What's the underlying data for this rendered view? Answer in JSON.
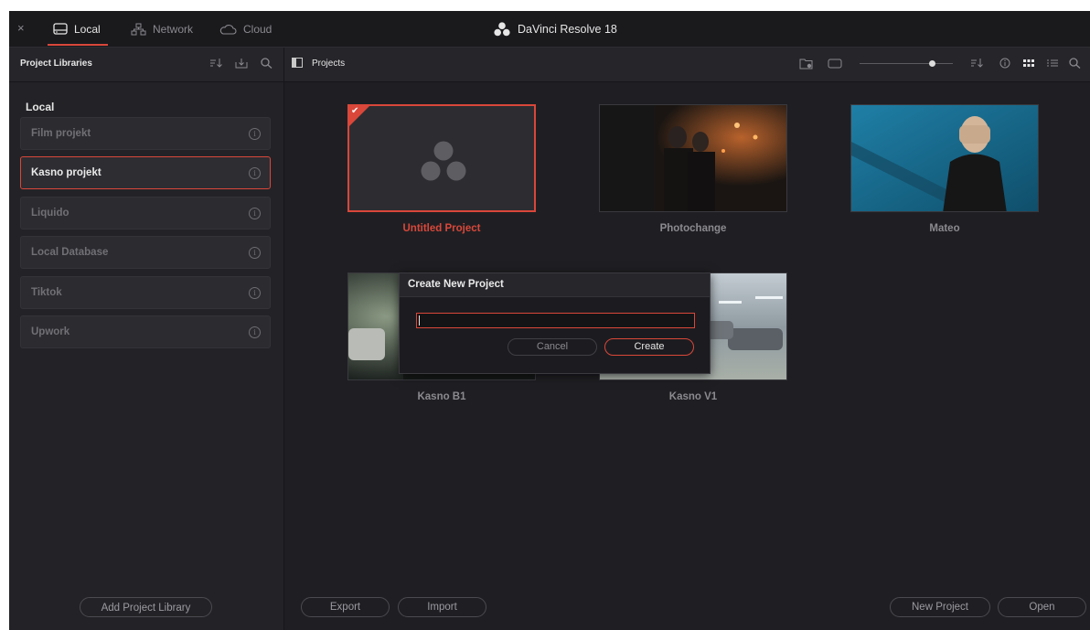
{
  "titlebar": {
    "tabs": [
      {
        "label": "Local",
        "icon": "drive-icon",
        "active": true
      },
      {
        "label": "Network",
        "icon": "network-icon",
        "active": false
      },
      {
        "label": "Cloud",
        "icon": "cloud-icon",
        "active": false
      }
    ],
    "app_title": "DaVinci Resolve 18",
    "close_label": "×"
  },
  "left_panel": {
    "title": "Project Libraries",
    "section_heading": "Local",
    "libraries": [
      {
        "label": "Film projekt",
        "selected": false
      },
      {
        "label": "Kasno projekt",
        "selected": true
      },
      {
        "label": "Liquido",
        "selected": false
      },
      {
        "label": "Local Database",
        "selected": false
      },
      {
        "label": "Tiktok",
        "selected": false
      },
      {
        "label": "Upwork",
        "selected": false
      }
    ],
    "add_button": "Add Project Library"
  },
  "main": {
    "title": "Projects",
    "projects": [
      {
        "name": "Untitled Project",
        "selected": true
      },
      {
        "name": "Photochange",
        "selected": false
      },
      {
        "name": "Mateo",
        "selected": false
      },
      {
        "name": "Kasno B1",
        "selected": false
      },
      {
        "name": "Kasno V1",
        "selected": false
      }
    ],
    "buttons": {
      "export": "Export",
      "import": "Import",
      "new_project": "New Project",
      "open": "Open"
    }
  },
  "dialog": {
    "title": "Create New Project",
    "input_value": "",
    "cancel": "Cancel",
    "create": "Create"
  },
  "colors": {
    "accent": "#d9473a",
    "background": "#1f1f23",
    "panel": "#232327"
  }
}
